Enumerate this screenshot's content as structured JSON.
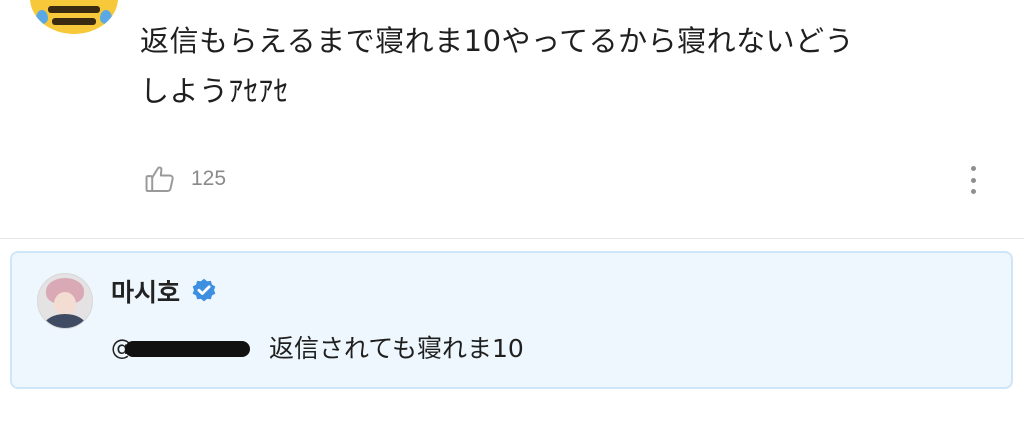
{
  "comment": {
    "avatar": "crying-bee-emoji-avatar",
    "text": "返信もらえるまで寝れま10やってるから寝れないどうしようｱｾｱｾ",
    "likes": "125",
    "like_icon": "thumbs-up-icon",
    "more_icon": "vertical-ellipsis-icon"
  },
  "reply": {
    "avatar": "profile-photo-avatar",
    "author": "마시호",
    "verified_icon": "verified-badge-icon",
    "mention_prefix": "@",
    "text": "返信されても寝れま10"
  },
  "colors": {
    "reply_background": "#eef7fd",
    "reply_border": "#cfe6f6",
    "verified_blue": "#3d8fe0",
    "meta_gray": "#8a8a8a"
  }
}
